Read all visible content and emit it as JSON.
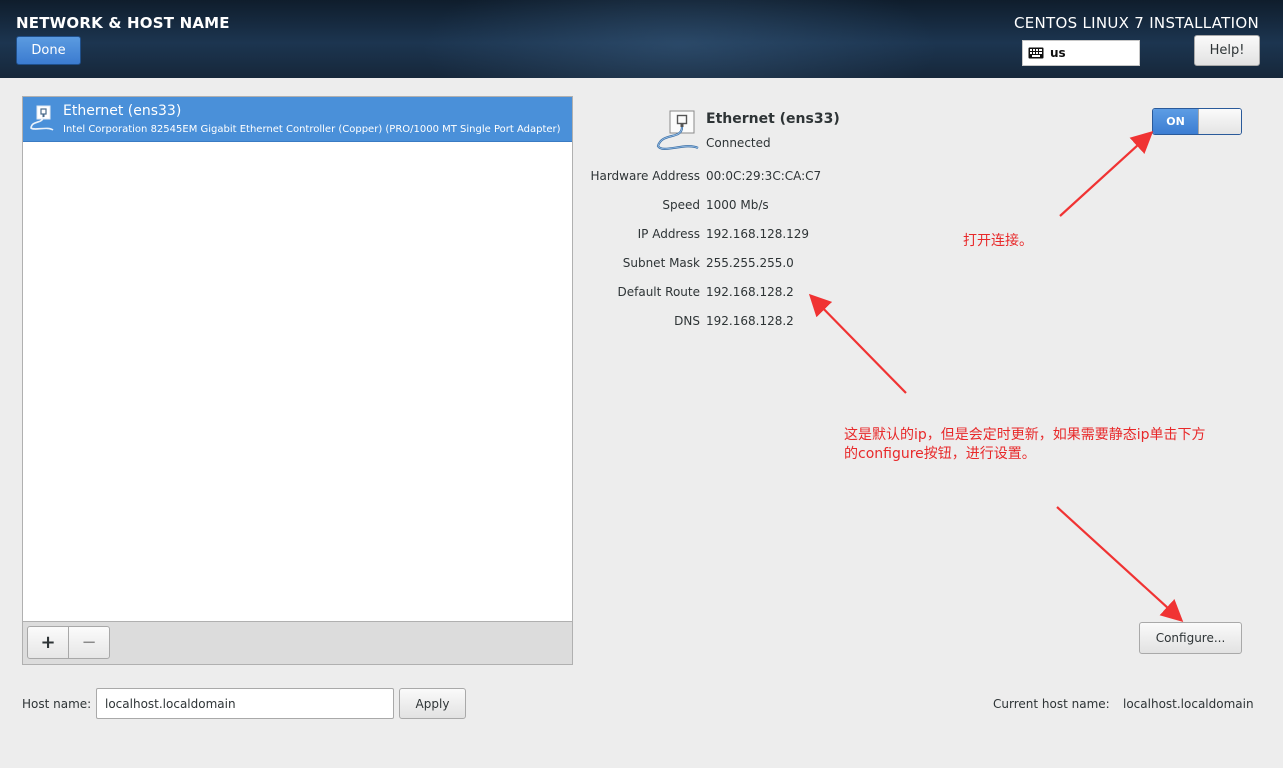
{
  "header": {
    "spoke_title": "NETWORK & HOST NAME",
    "done_label": "Done",
    "product_title": "CENTOS LINUX 7 INSTALLATION",
    "keyboard_layout": "us",
    "help_label": "Help!"
  },
  "device_list": {
    "items": [
      {
        "name": "Ethernet (ens33)",
        "description": "Intel Corporation 82545EM Gigabit Ethernet Controller (Copper) (PRO/1000 MT Single Port Adapter)",
        "selected": true
      }
    ],
    "add_label": "+",
    "remove_label": "−"
  },
  "details": {
    "name": "Ethernet (ens33)",
    "status": "Connected",
    "toggle_label": "ON",
    "toggle_state": true,
    "properties": [
      {
        "label": "Hardware Address",
        "value": "00:0C:29:3C:CA:C7"
      },
      {
        "label": "Speed",
        "value": "1000 Mb/s"
      },
      {
        "label": "IP Address",
        "value": "192.168.128.129"
      },
      {
        "label": "Subnet Mask",
        "value": "255.255.255.0"
      },
      {
        "label": "Default Route",
        "value": "192.168.128.2"
      },
      {
        "label": "DNS",
        "value": "192.168.128.2"
      }
    ],
    "configure_label": "Configure..."
  },
  "hostname": {
    "label": "Host name:",
    "value": "localhost.localdomain",
    "apply_label": "Apply",
    "current_label": "Current host name:",
    "current_value": "localhost.localdomain"
  },
  "annotations": {
    "toggle_note": "打开连接。",
    "ip_note_line1": "这是默认的ip，但是会定时更新，如果需要静态ip单击下方",
    "ip_note_line2": "的configure按钮，进行设置。"
  },
  "colors": {
    "accent": "#4a90d9",
    "annotation": "#e8292a",
    "header_bg": "#16273a"
  }
}
